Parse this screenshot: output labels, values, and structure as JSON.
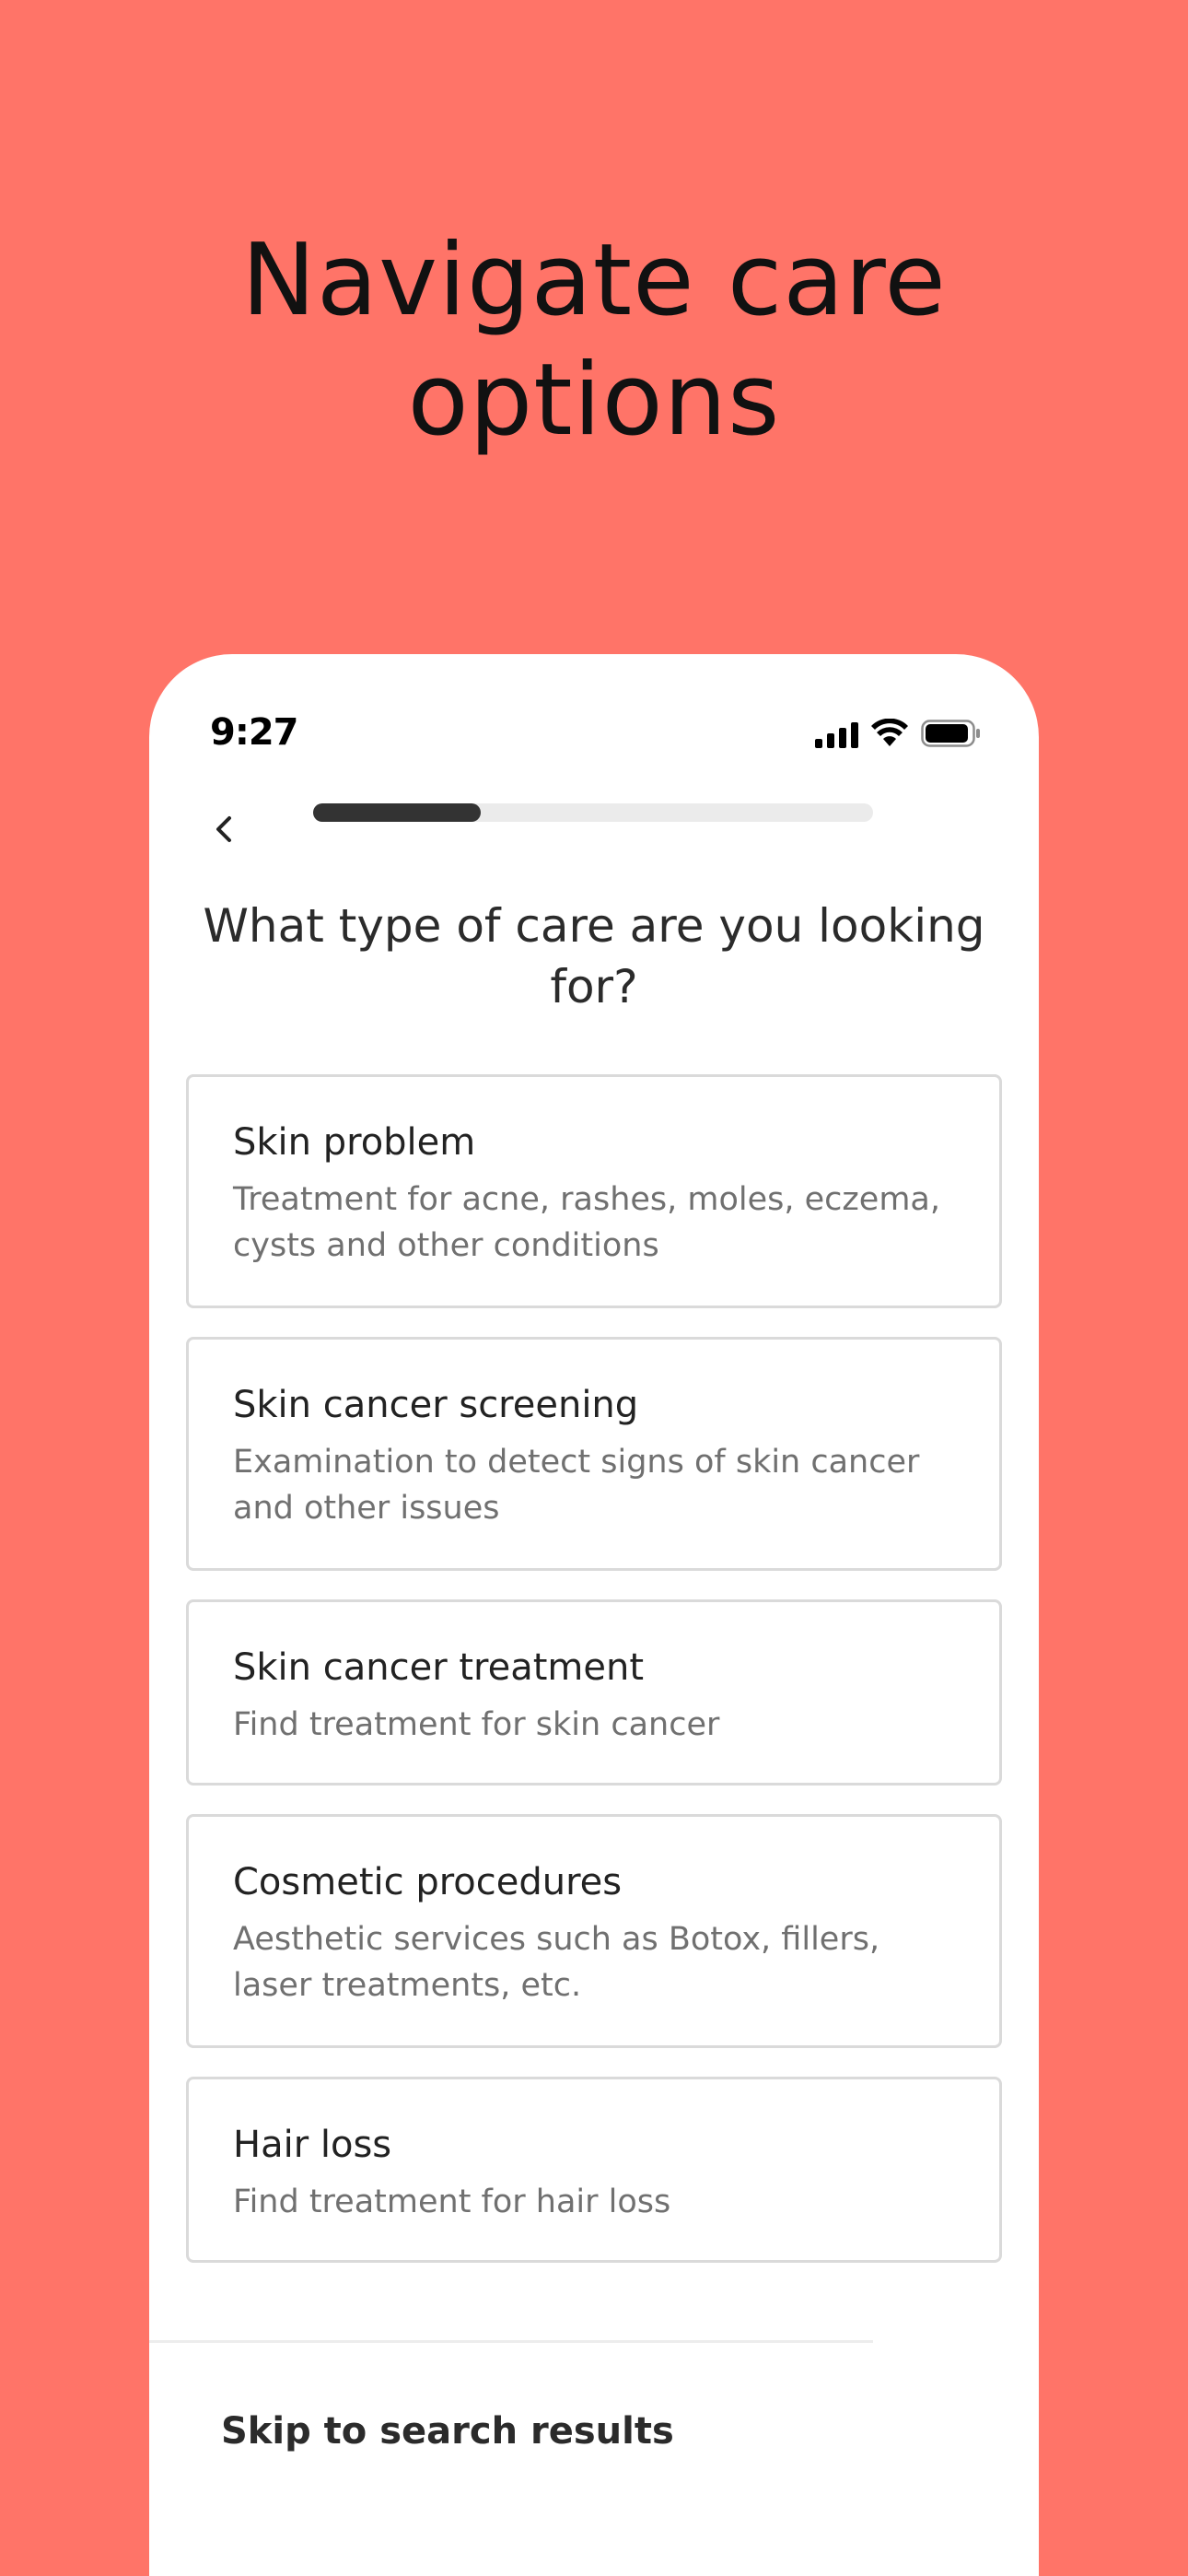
{
  "hero": {
    "title_line1": "Navigate care",
    "title_line2": "options"
  },
  "status_bar": {
    "time": "9:27",
    "icons": [
      "cellular-signal-icon",
      "wifi-icon",
      "battery-icon"
    ]
  },
  "nav": {
    "back_icon": "chevron-left-icon",
    "progress": 0.3
  },
  "question": "What type of care are you looking for?",
  "options": [
    {
      "title": "Skin problem",
      "description": "Treatment for acne, rashes, moles, eczema, cysts and other conditions"
    },
    {
      "title": "Skin cancer screening",
      "description": "Examination to detect signs of skin cancer and other issues"
    },
    {
      "title": "Skin cancer treatment",
      "description": "Find treatment for skin cancer"
    },
    {
      "title": "Cosmetic procedures",
      "description": "Aesthetic services such as Botox, fillers, laser treatments, etc."
    },
    {
      "title": "Hair loss",
      "description": "Find treatment for hair loss"
    }
  ],
  "skip_link": "Skip to search results",
  "colors": {
    "background": "#FF7468",
    "card": "#FFFFFF",
    "progress_fill": "#333333",
    "progress_track": "#EBEBEB"
  }
}
